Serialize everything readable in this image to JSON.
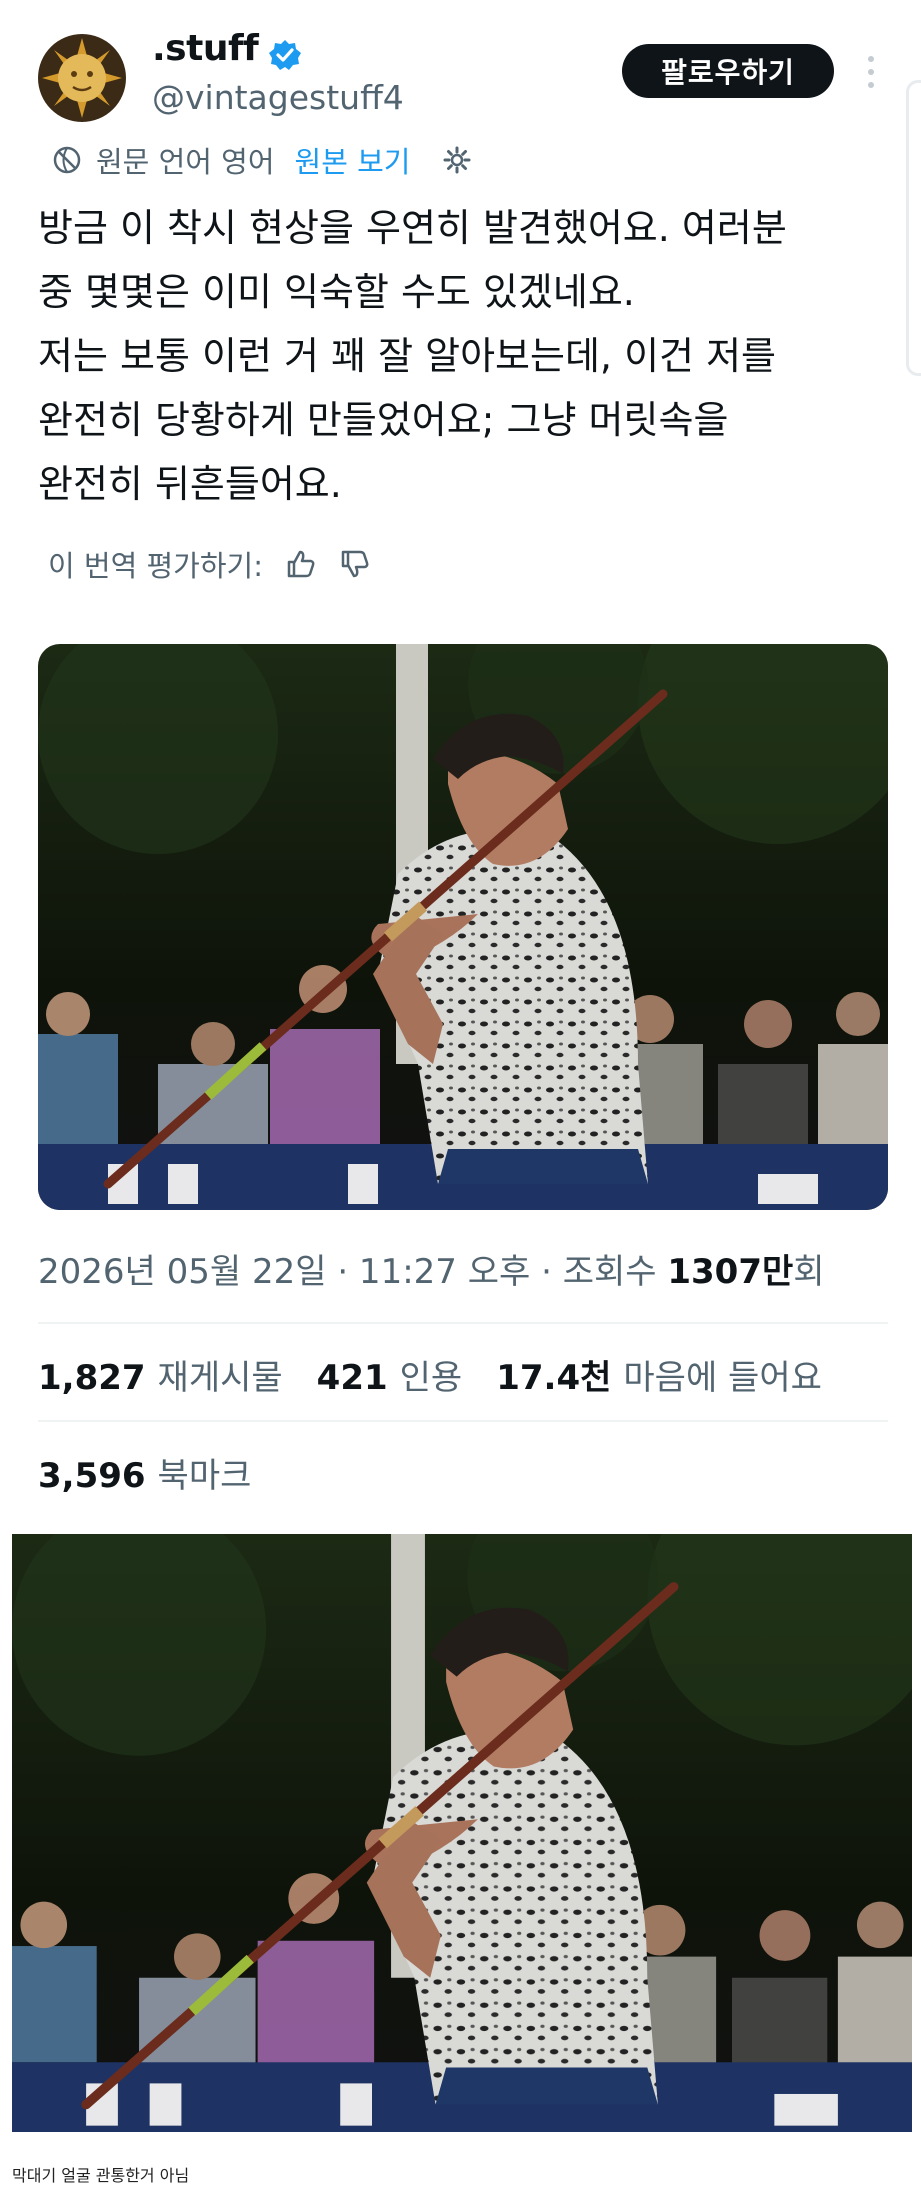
{
  "author": {
    "display_name": ".stuff",
    "handle": "@vintagestuff4",
    "verified": true
  },
  "follow_button": "팔로우하기",
  "translation": {
    "notice": "원문 언어 영어",
    "show_original": "원본 보기"
  },
  "tweet": {
    "text": "방금 이 착시 현상을 우연히 발견했어요. 여러분\n중 몇몇은 이미 익숙할 수도 있겠네요.\n저는 보통 이런 거 꽤 잘 알아보는데, 이건 저를\n완전히 당황하게 만들었어요; 그냥 머릿속을\n완전히 뒤흔들어요."
  },
  "rate_translation": "이 번역 평가하기:",
  "meta": {
    "timestamp": "2026년 05월 22일 · 11:27 오후 · 조회수 ",
    "views_value": "1307만",
    "views_unit": "회"
  },
  "stats": {
    "reposts_count": "1,827",
    "reposts_label": "재게시물",
    "quotes_count": "421",
    "quotes_label": "인용",
    "likes_count": "17.4천",
    "likes_label": "마음에 들어요",
    "bookmarks_count": "3,596",
    "bookmarks_label": "북마크"
  },
  "caption": "막대기 얼굴 관통한거 아님",
  "colors": {
    "accent": "#1d9bf0",
    "text_primary": "#0f1419",
    "text_secondary": "#536471",
    "button_bg": "#0f1419"
  },
  "icons": [
    "globe-translate-icon",
    "gear-icon",
    "verified-badge-icon",
    "more-icon",
    "thumbs-up-icon",
    "thumbs-down-icon"
  ]
}
